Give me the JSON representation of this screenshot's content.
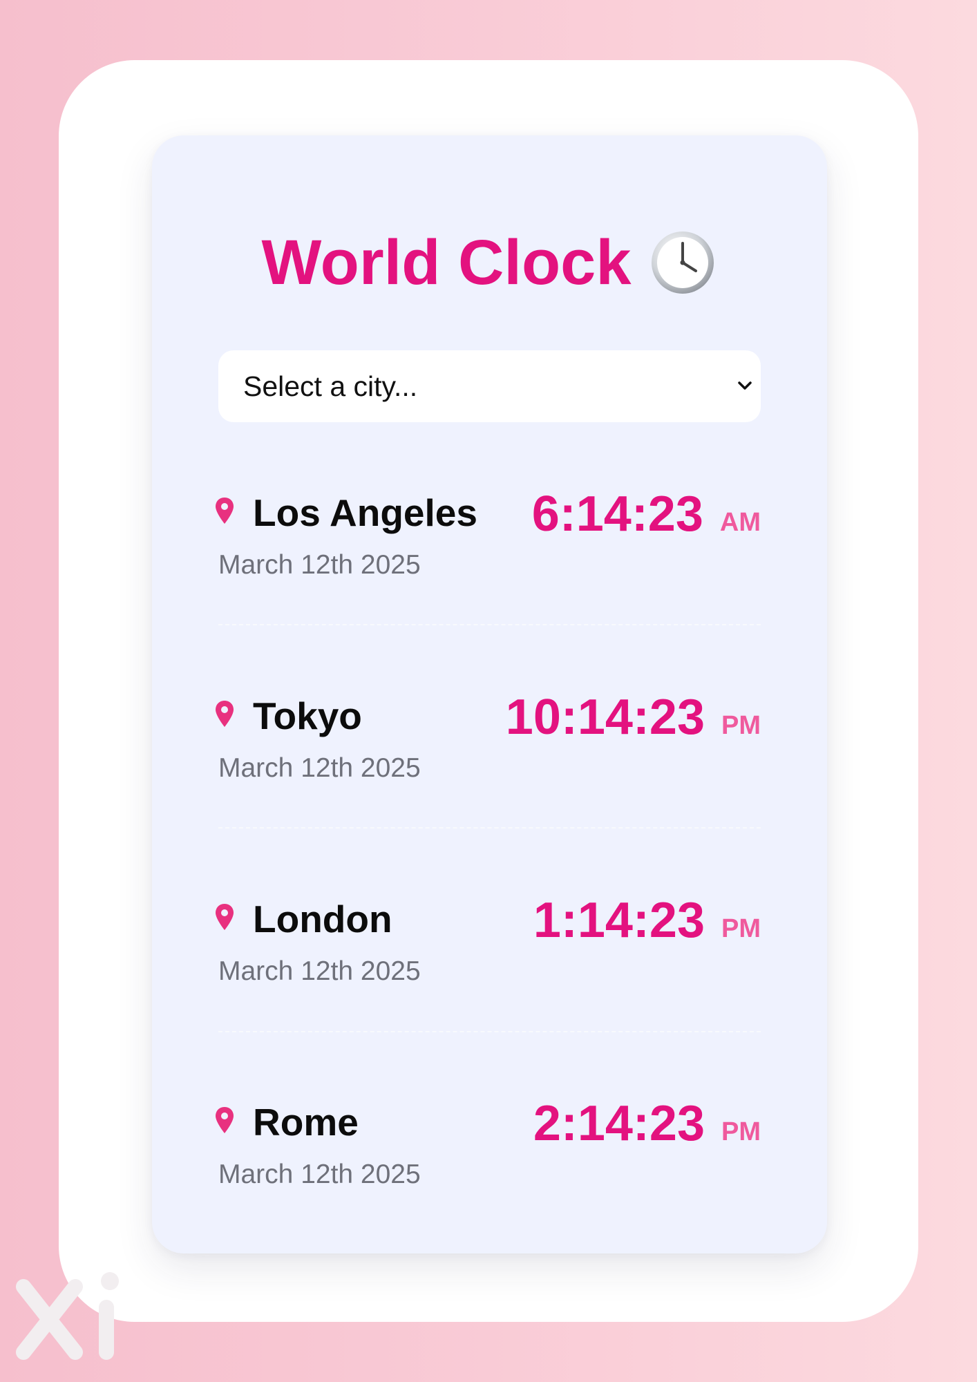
{
  "app": {
    "title": "World Clock",
    "title_icon": "clock-icon"
  },
  "city_select": {
    "placeholder": "Select a city..."
  },
  "cities": [
    {
      "name": "Los Angeles",
      "date": "March 12th 2025",
      "time": "6:14:23",
      "period": "AM"
    },
    {
      "name": "Tokyo",
      "date": "March 12th 2025",
      "time": "10:14:23",
      "period": "PM"
    },
    {
      "name": "London",
      "date": "March 12th 2025",
      "time": "1:14:23",
      "period": "PM"
    },
    {
      "name": "Rome",
      "date": "March 12th 2025",
      "time": "2:14:23",
      "period": "PM"
    }
  ],
  "colors": {
    "accent": "#e3127f",
    "period": "#ef5a9d",
    "card_background": "#eff2fe",
    "date_text": "#6e707a"
  }
}
